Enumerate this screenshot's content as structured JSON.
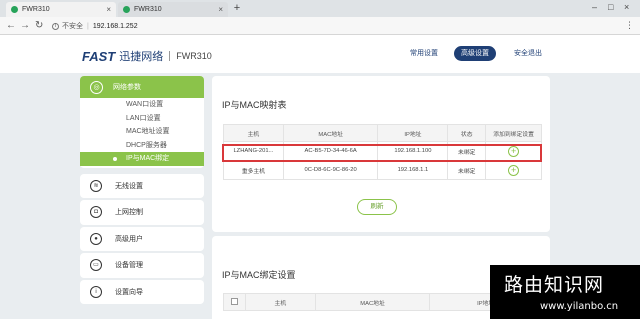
{
  "browser": {
    "tabs": [
      {
        "title": "FWR310",
        "active": true
      },
      {
        "title": "FWR310",
        "active": false
      }
    ],
    "address": {
      "security_label": "不安全",
      "url": "192.168.1.252"
    }
  },
  "header": {
    "brand": "FAST",
    "brand_cn": "迅捷网络",
    "model": "FWR310",
    "nav": [
      "常用设置",
      "高级设置",
      "安全退出"
    ],
    "active_nav": "高级设置"
  },
  "sidebar": {
    "network_group": {
      "label": "网络参数",
      "items": [
        "WAN口设置",
        "LAN口设置",
        "MAC地址设置",
        "DHCP服务器",
        "IP与MAC绑定"
      ],
      "active_item": "IP与MAC绑定"
    },
    "menu": [
      {
        "label": "无线设置",
        "icon": "wifi-icon"
      },
      {
        "label": "上网控制",
        "icon": "shield-icon"
      },
      {
        "label": "高级用户",
        "icon": "user-icon"
      },
      {
        "label": "设备管理",
        "icon": "device-icon"
      },
      {
        "label": "设置向导",
        "icon": "info-icon"
      }
    ]
  },
  "mapping_table": {
    "title": "IP与MAC映射表",
    "columns": [
      "主机",
      "MAC地址",
      "IP地址",
      "状态",
      "添加到绑定设置"
    ],
    "rows": [
      {
        "host": "LZHANG-201...",
        "mac": "AC-B5-7D-34-46-6A",
        "ip": "192.168.1.100",
        "status": "未绑定"
      },
      {
        "host": "重多主机",
        "mac": "0C-D8-6C-9C-86-20",
        "ip": "192.168.1.1",
        "status": "未绑定"
      }
    ],
    "refresh_label": "刷新"
  },
  "binding_settings": {
    "title": "IP与MAC绑定设置",
    "columns": [
      "主机",
      "MAC地址",
      "IP地址"
    ]
  },
  "watermark": {
    "title": "路由知识网",
    "url": "www.yilanbo.cn"
  },
  "colors": {
    "accent_green": "#8bc34a",
    "brand_blue": "#1f3f75",
    "highlight_red": "#d9383a"
  }
}
